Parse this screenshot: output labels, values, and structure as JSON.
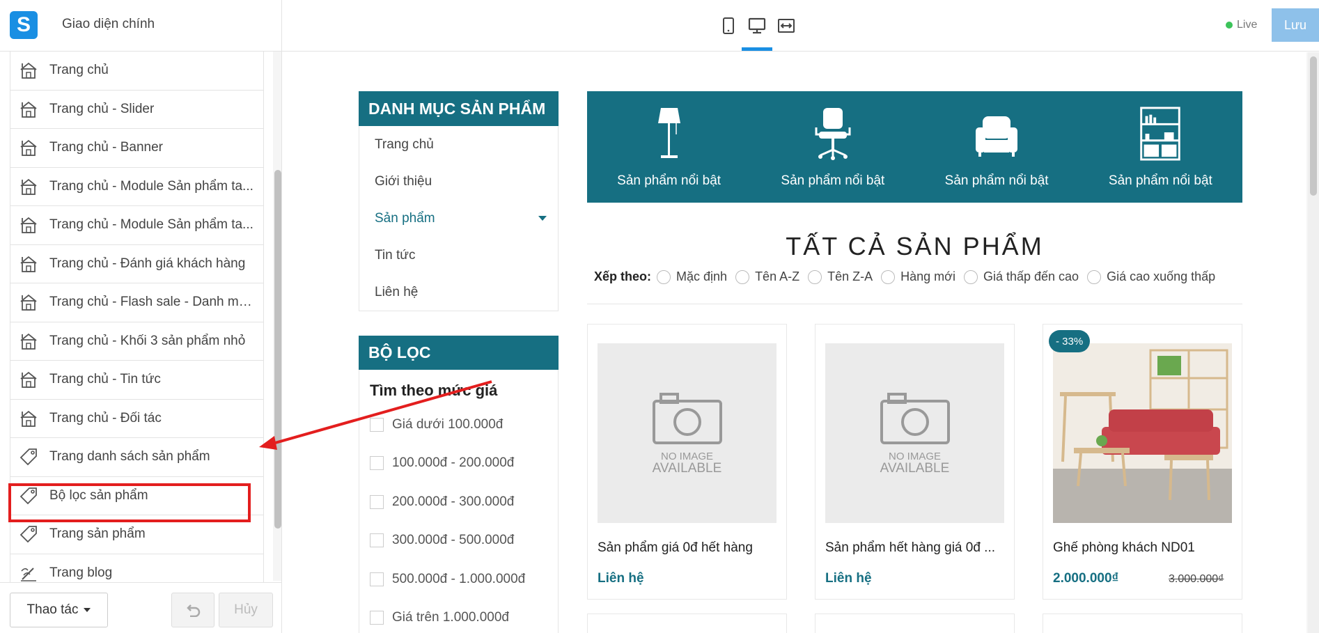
{
  "app": {
    "logo_letter": "S",
    "theme_title": "Giao diện chính",
    "live_label": "Live",
    "save_label": "Lưu",
    "device_buttons": [
      "mobile-icon",
      "desktop-icon",
      "fullwidth-icon"
    ],
    "active_device": "desktop"
  },
  "sidebar": {
    "items": [
      {
        "label": "Trang chủ",
        "icon": "house-icon"
      },
      {
        "label": "Trang chủ - Slider",
        "icon": "house-icon"
      },
      {
        "label": "Trang chủ - Banner",
        "icon": "house-icon"
      },
      {
        "label": "Trang chủ - Module Sản phẩm ta...",
        "icon": "house-icon"
      },
      {
        "label": "Trang chủ - Module Sản phẩm ta...",
        "icon": "house-icon"
      },
      {
        "label": "Trang chủ - Đánh giá khách hàng",
        "icon": "house-icon"
      },
      {
        "label": "Trang chủ - Flash sale - Danh mụ...",
        "icon": "house-icon"
      },
      {
        "label": "Trang chủ - Khối 3 sản phẩm nhỏ",
        "icon": "house-icon"
      },
      {
        "label": "Trang chủ - Tin tức",
        "icon": "house-icon"
      },
      {
        "label": "Trang chủ - Đối tác",
        "icon": "house-icon"
      },
      {
        "label": "Trang danh sách sản phẩm",
        "icon": "tag-icon"
      },
      {
        "label": "Bộ lọc sản phẩm",
        "icon": "tag-icon"
      },
      {
        "label": "Trang sản phẩm",
        "icon": "tag-icon"
      },
      {
        "label": "Trang blog",
        "icon": "blog-icon"
      }
    ],
    "highlighted_index": 10,
    "actions_label": "Thao tác",
    "cancel_label": "Hủy"
  },
  "preview": {
    "category_title": "DANH MỤC SẢN PHẨM",
    "categories": [
      {
        "label": "Trang chủ",
        "active": false
      },
      {
        "label": "Giới thiệu",
        "active": false
      },
      {
        "label": "Sản phẩm",
        "active": true
      },
      {
        "label": "Tin tức",
        "active": false
      },
      {
        "label": "Liên hệ",
        "active": false
      }
    ],
    "filter_title": "BỘ LỌC",
    "price_filter_title": "Tìm theo mức giá",
    "price_options": [
      "Giá dưới 100.000đ",
      "100.000đ - 200.000đ",
      "200.000đ - 300.000đ",
      "300.000đ - 500.000đ",
      "500.000đ - 1.000.000đ",
      "Giá trên 1.000.000đ"
    ],
    "features": [
      {
        "label": "Sản phẩm nổi bật",
        "icon": "lamp-icon"
      },
      {
        "label": "Sản phẩm nổi bật",
        "icon": "office-chair-icon"
      },
      {
        "label": "Sản phẩm nổi bật",
        "icon": "armchair-icon"
      },
      {
        "label": "Sản phẩm nổi bật",
        "icon": "bookshelf-icon"
      }
    ],
    "all_products_title": "TẤT CẢ SẢN PHẨM",
    "sort_label": "Xếp theo:",
    "sort_options": [
      "Mặc định",
      "Tên A-Z",
      "Tên Z-A",
      "Hàng mới",
      "Giá thấp đến cao",
      "Giá cao xuống thấp"
    ],
    "products": [
      {
        "name": "Sản phẩm giá 0đ hết hàng",
        "price": "Liên hệ",
        "old_price": "",
        "badge": "",
        "image": "no-image",
        "noimg_line1": "NO IMAGE",
        "noimg_line2": "AVAILABLE"
      },
      {
        "name": "Sản phẩm hết hàng giá 0đ ...",
        "price": "Liên hệ",
        "old_price": "",
        "badge": "",
        "image": "no-image",
        "noimg_line1": "NO IMAGE",
        "noimg_line2": "AVAILABLE"
      },
      {
        "name": "Ghế phòng khách ND01",
        "price": "2.000.000₫",
        "old_price": "3.000.000₫",
        "badge": "- 33%",
        "image": "living-room-photo"
      }
    ]
  },
  "colors": {
    "brand": "#1a8fe3",
    "teal": "#166f82",
    "live_green": "#3cc35a",
    "annotation_red": "#e31e1e"
  }
}
